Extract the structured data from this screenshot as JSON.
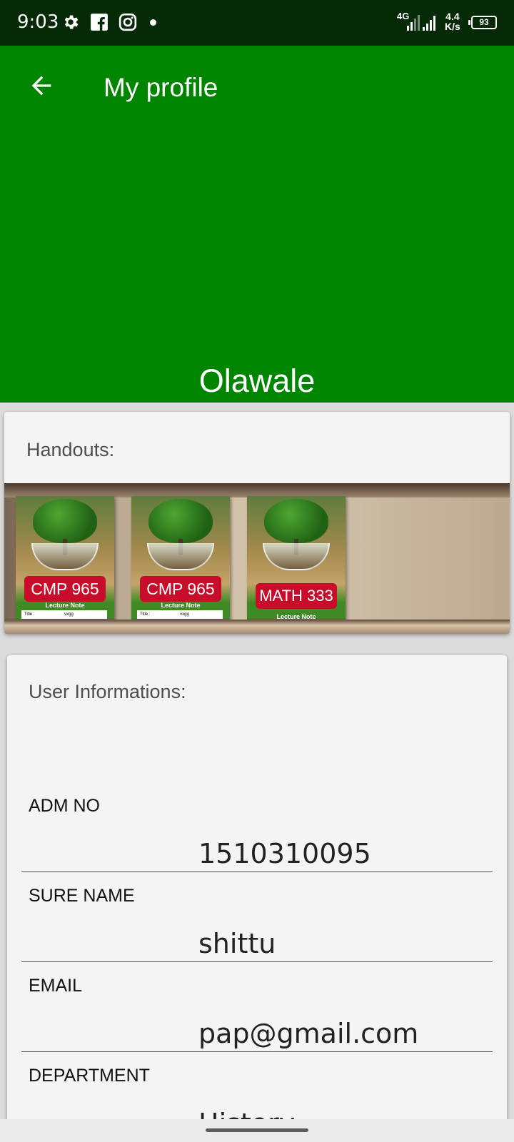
{
  "status_bar": {
    "time": "9:03",
    "network_type": "4G",
    "speed_value": "4.4",
    "speed_unit": "K/s",
    "battery": "93",
    "icons": [
      "gear-icon",
      "facebook-icon",
      "instagram-icon",
      "dot-icon",
      "signal-icon",
      "signal-icon",
      "battery-icon"
    ]
  },
  "header": {
    "title": "My profile",
    "back_icon": "arrow-left-icon",
    "username": "Olawale",
    "background_color": "#008500"
  },
  "handouts": {
    "title": "Handouts:",
    "books": [
      {
        "code": "CMP 965",
        "note": "Lecture Note",
        "title_label": "Title :",
        "title_value": "vxgg"
      },
      {
        "code": "CMP 965",
        "note": "Lecture Note",
        "title_label": "Title :",
        "title_value": "vxgg"
      },
      {
        "code": "MATH 333",
        "note": "Lecture Note"
      }
    ]
  },
  "user_info": {
    "title": "User Informations:",
    "fields": [
      {
        "label": "ADM NO",
        "value": "1510310095"
      },
      {
        "label": "SURE NAME",
        "value": "shittu"
      },
      {
        "label": "EMAIL",
        "value": "pap@gmail.com"
      },
      {
        "label": "DEPARTMENT",
        "value": "History"
      }
    ]
  }
}
